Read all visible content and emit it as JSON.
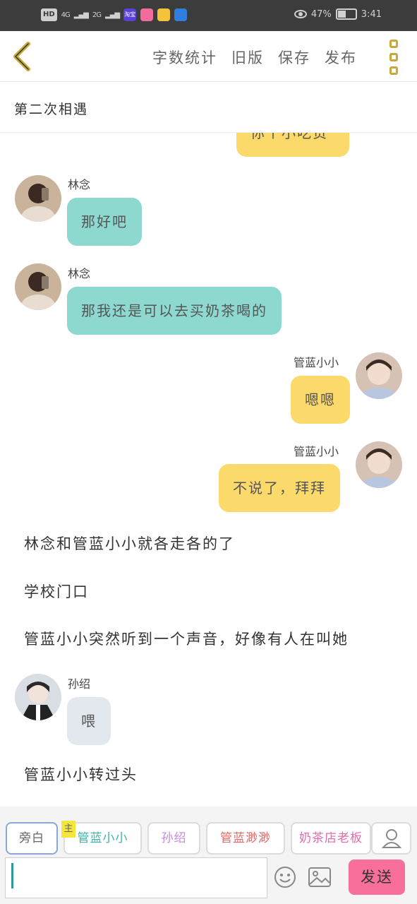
{
  "status_bar": {
    "left_text": "HD",
    "signal_1": "4G",
    "signal_2": "2G",
    "apps": [
      "淘宝",
      "",
      "",
      ""
    ],
    "battery_percent": "47%",
    "time": "3:41",
    "battery_level": 0.47
  },
  "toolbar": {
    "back_icon": "chevron-left-icon",
    "actions": [
      "字数统计",
      "旧版",
      "保存",
      "发布"
    ],
    "more_icon": "more-vertical-icon"
  },
  "title": "第二次相遇",
  "chat": {
    "partial_bubble": "你个小吃货",
    "messages": [
      {
        "speaker": "林念",
        "text": "那好吧",
        "side": "left"
      },
      {
        "speaker": "林念",
        "text": "那我还是可以去买奶茶喝的",
        "side": "left"
      },
      {
        "speaker": "管蓝小小",
        "text": "嗯嗯",
        "side": "right"
      },
      {
        "speaker": "管蓝小小",
        "text": "不说了，拜拜",
        "side": "right"
      },
      {
        "speaker": "孙绍",
        "text": "喂",
        "side": "left"
      }
    ],
    "narrations": [
      "林念和管蓝小小就各走各的了",
      "学校门口",
      "管蓝小小突然听到一个声音，好像有人在叫她",
      "管蓝小小转过头"
    ]
  },
  "composer": {
    "roles": [
      "旁白",
      "管蓝小小",
      "孙绍",
      "管蓝渺渺",
      "奶茶店老板"
    ],
    "owner_tag": "主",
    "role_colors": [
      "#666666",
      "#3fb5ae",
      "#c48ae0",
      "#e06b6b",
      "#e06bb0"
    ],
    "send_label": "发送",
    "icons": [
      "emoji-icon",
      "image-icon",
      "person-icon"
    ]
  }
}
